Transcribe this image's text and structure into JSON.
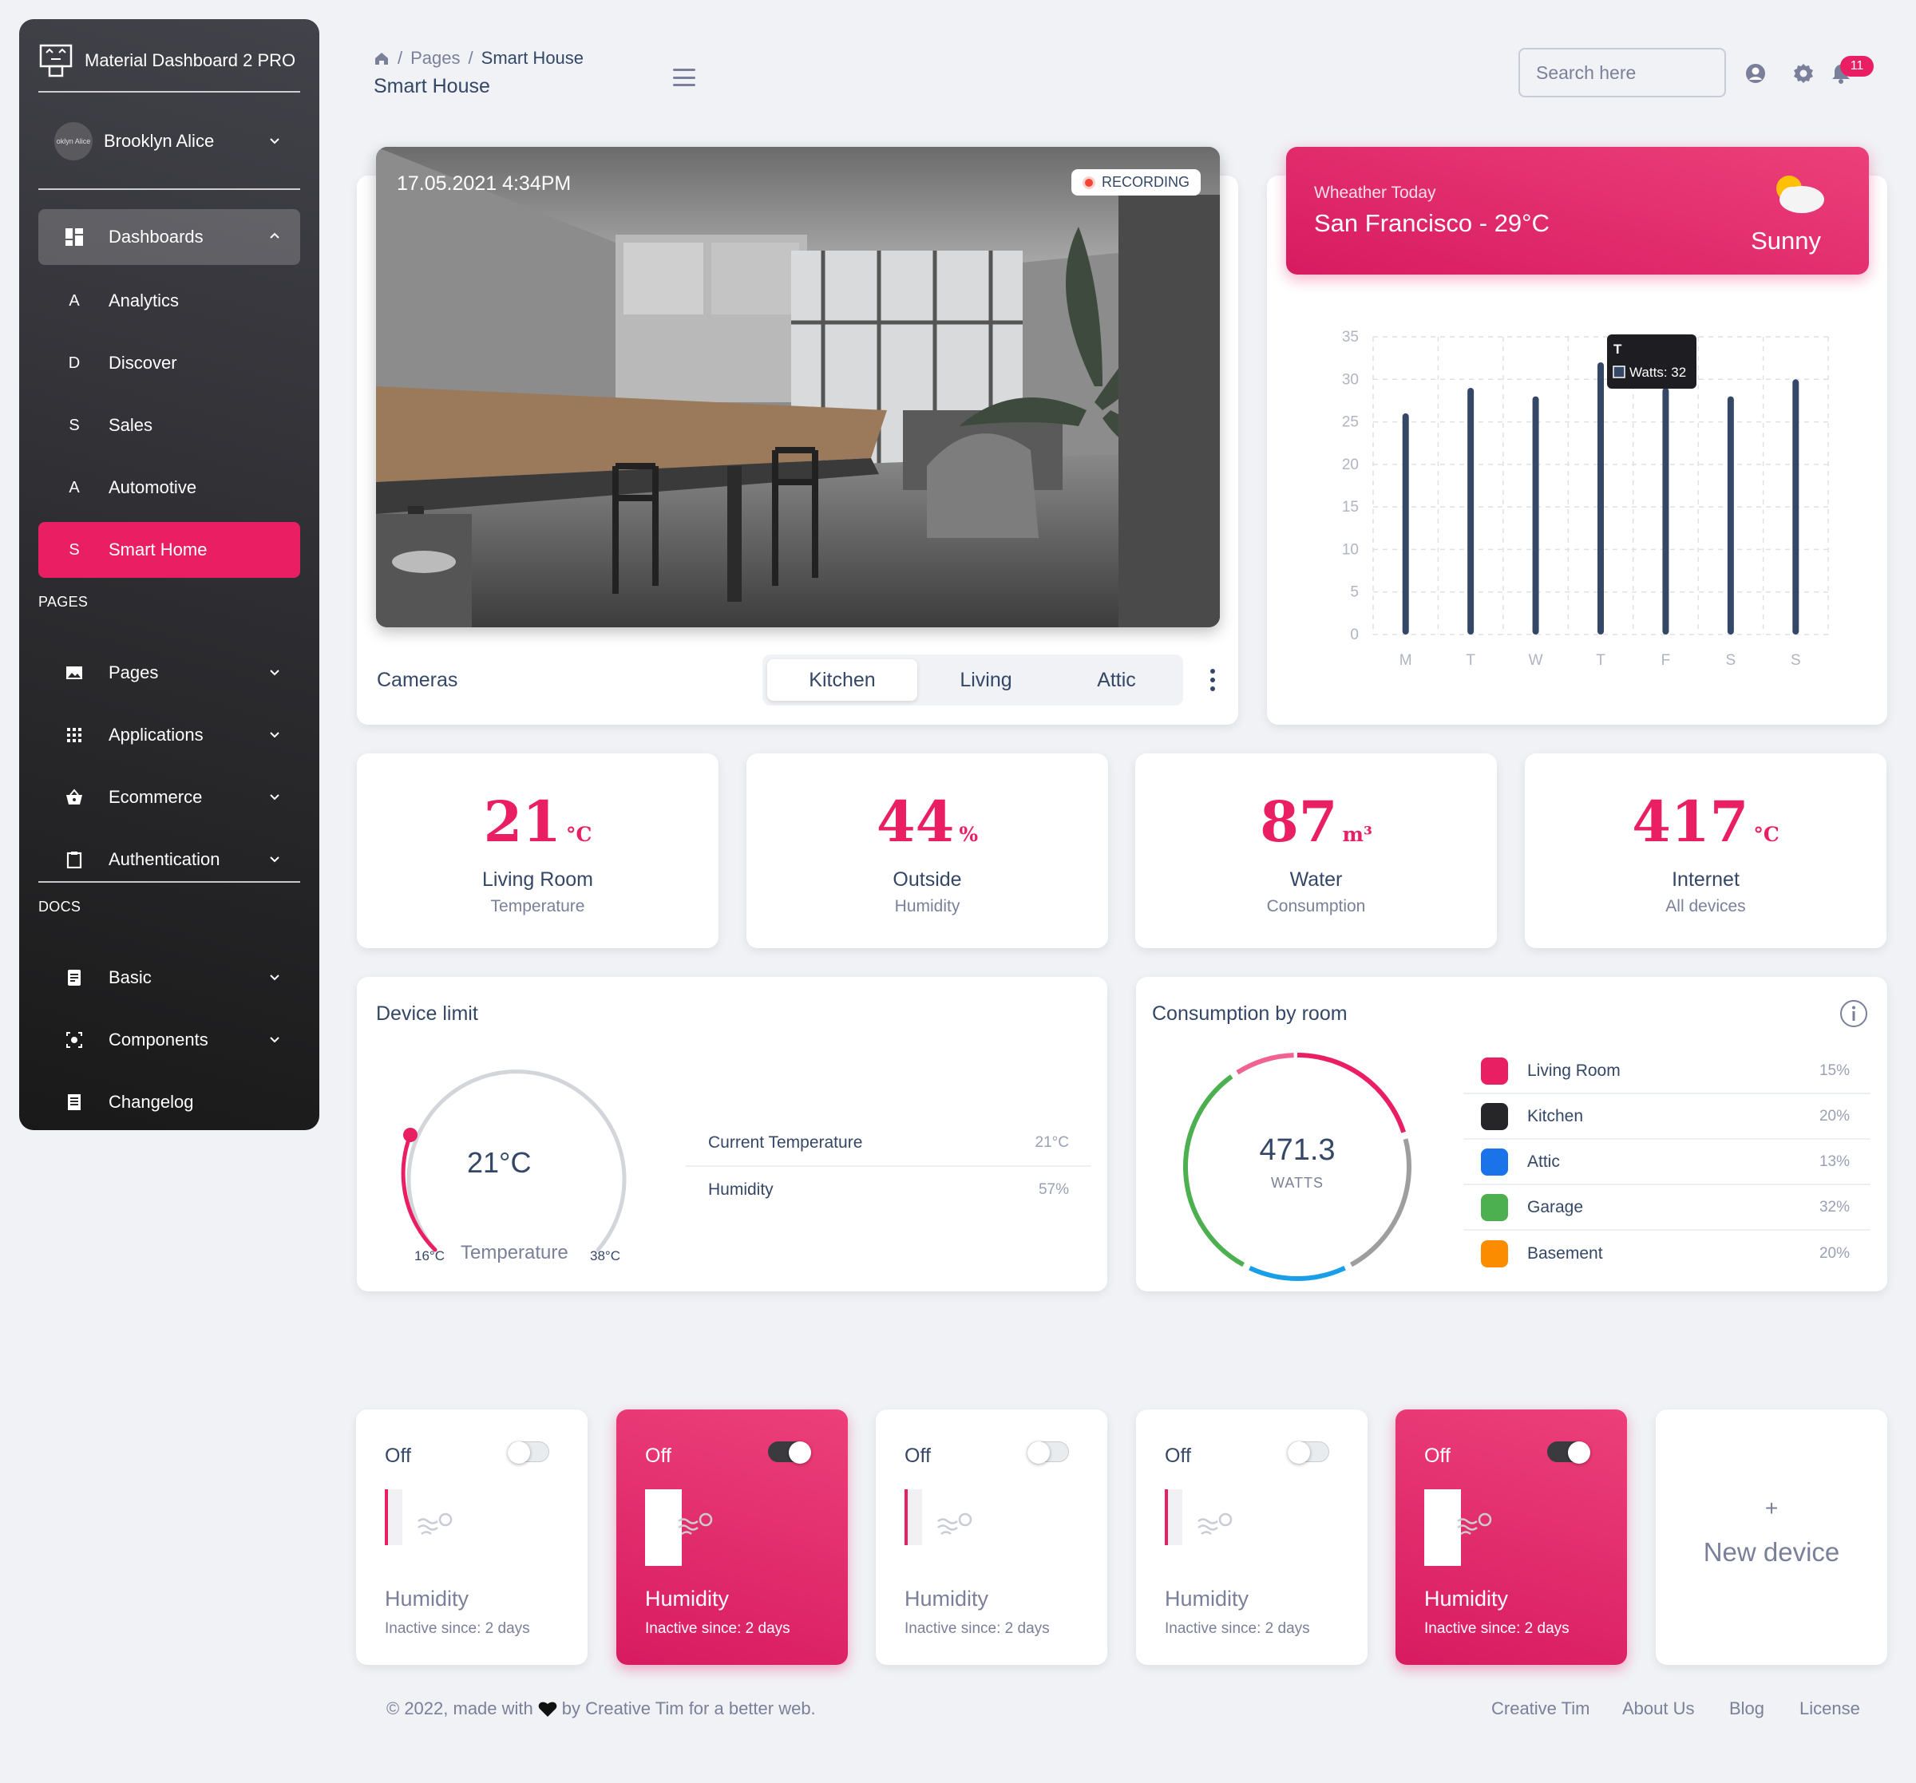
{
  "sidebar": {
    "brand": "Material Dashboard 2 PRO",
    "user": {
      "name": "Brooklyn Alice",
      "avatar_text": "oklyn Alice"
    },
    "dashboards_label": "Dashboards",
    "dashboard_items": [
      {
        "letter": "A",
        "label": "Analytics"
      },
      {
        "letter": "D",
        "label": "Discover"
      },
      {
        "letter": "S",
        "label": "Sales"
      },
      {
        "letter": "A",
        "label": "Automotive"
      },
      {
        "letter": "S",
        "label": "Smart Home"
      }
    ],
    "pages_section": "PAGES",
    "pages_items": [
      "Pages",
      "Applications",
      "Ecommerce",
      "Authentication"
    ],
    "docs_section": "DOCS",
    "docs_items": [
      "Basic",
      "Components",
      "Changelog"
    ]
  },
  "header": {
    "breadcrumb": [
      "Pages",
      "Smart House"
    ],
    "title": "Smart House",
    "search_placeholder": "Search here",
    "notification_count": "11"
  },
  "camera": {
    "timestamp": "17.05.2021 4:34PM",
    "recording_label": "RECORDING",
    "label": "Cameras",
    "tabs": [
      "Kitchen",
      "Living",
      "Attic"
    ],
    "active_tab": "Kitchen"
  },
  "weather": {
    "label": "Wheather Today",
    "city": "San Francisco - 29°C",
    "condition": "Sunny"
  },
  "chart_data": {
    "type": "bar",
    "categories": [
      "M",
      "T",
      "W",
      "T",
      "F",
      "S",
      "S"
    ],
    "series": [
      {
        "name": "Watts",
        "values": [
          26,
          29,
          28,
          32,
          29,
          28,
          30
        ]
      }
    ],
    "ylim": [
      0,
      35
    ],
    "yticks": [
      0,
      5,
      10,
      15,
      20,
      25,
      30,
      35
    ],
    "grid": true,
    "tooltip": {
      "title": "T",
      "label": "Watts: 32"
    },
    "color": "#344767"
  },
  "stats": [
    {
      "value": "21",
      "unit": "°C",
      "title": "Living Room",
      "sub": "Temperature"
    },
    {
      "value": "44",
      "unit": "%",
      "title": "Outside",
      "sub": "Humidity"
    },
    {
      "value": "87",
      "unit": "m³",
      "title": "Water",
      "sub": "Consumption"
    },
    {
      "value": "417",
      "unit": "°C",
      "title": "Internet",
      "sub": "All devices"
    }
  ],
  "device_limit": {
    "title": "Device limit",
    "gauge_value": "21°C",
    "gauge_label": "Temperature",
    "min": "16°C",
    "max": "38°C",
    "rows": [
      {
        "label": "Current Temperature",
        "value": "21°C"
      },
      {
        "label": "Humidity",
        "value": "57%"
      }
    ]
  },
  "consumption": {
    "title": "Consumption by room",
    "total": "471.3",
    "unit": "WATTS",
    "rooms": [
      {
        "name": "Living Room",
        "pct": "15%",
        "color": "#e91e63"
      },
      {
        "name": "Kitchen",
        "pct": "20%",
        "color": "#344767"
      },
      {
        "name": "Attic",
        "pct": "13%",
        "color": "#1a73e8"
      },
      {
        "name": "Garage",
        "pct": "32%",
        "color": "#4caf50"
      },
      {
        "name": "Basement",
        "pct": "20%",
        "color": "#fb8c00"
      }
    ]
  },
  "devices": [
    {
      "state": "Off",
      "name": "Humidity",
      "since": "Inactive since: 2 days",
      "on": false
    },
    {
      "state": "Off",
      "name": "Humidity",
      "since": "Inactive since: 2 days",
      "on": true
    },
    {
      "state": "Off",
      "name": "Humidity",
      "since": "Inactive since: 2 days",
      "on": false
    },
    {
      "state": "Off",
      "name": "Humidity",
      "since": "Inactive since: 2 days",
      "on": false
    },
    {
      "state": "Off",
      "name": "Humidity",
      "since": "Inactive since: 2 days",
      "on": true
    }
  ],
  "new_device": {
    "plus": "+",
    "label": "New device"
  },
  "footer": {
    "copyright_pre": "© 2022, made with",
    "copyright_post": "by Creative Tim for a better web.",
    "links": [
      "Creative Tim",
      "About Us",
      "Blog",
      "License"
    ]
  },
  "colors": {
    "primary": "#e91e63",
    "dark": "#344767",
    "muted": "#7b809a"
  }
}
